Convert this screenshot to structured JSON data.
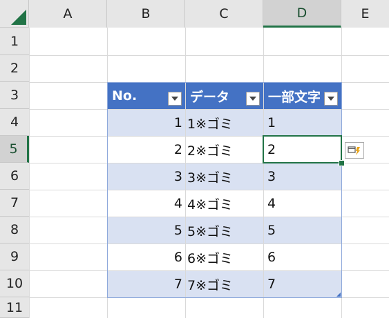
{
  "columns": [
    "A",
    "B",
    "C",
    "D",
    "E"
  ],
  "rows": [
    "1",
    "2",
    "3",
    "4",
    "5",
    "6",
    "7",
    "8",
    "9",
    "10",
    "11"
  ],
  "active_cell": {
    "column": "D",
    "row": "5"
  },
  "table": {
    "headers": [
      "No.",
      "データ",
      "一部文字"
    ],
    "rows": [
      {
        "no": "1",
        "data": "1※ゴミ",
        "part": "1"
      },
      {
        "no": "2",
        "data": "2※ゴミ",
        "part": "2"
      },
      {
        "no": "3",
        "data": "3※ゴミ",
        "part": "3"
      },
      {
        "no": "4",
        "data": "4※ゴミ",
        "part": "4"
      },
      {
        "no": "5",
        "data": "5※ゴミ",
        "part": "5"
      },
      {
        "no": "6",
        "data": "6※ゴミ",
        "part": "6"
      },
      {
        "no": "7",
        "data": "7※ゴミ",
        "part": "7"
      }
    ]
  },
  "icons": {
    "filter_dropdown": "chevron-down-icon",
    "quick_analysis": "flash-fill-options-icon",
    "select_all": "select-all-triangle-icon"
  },
  "colors": {
    "header_blue": "#4472c4",
    "band_blue": "#d9e1f2",
    "selection_green": "#217346",
    "flash_orange": "#e8a317"
  }
}
